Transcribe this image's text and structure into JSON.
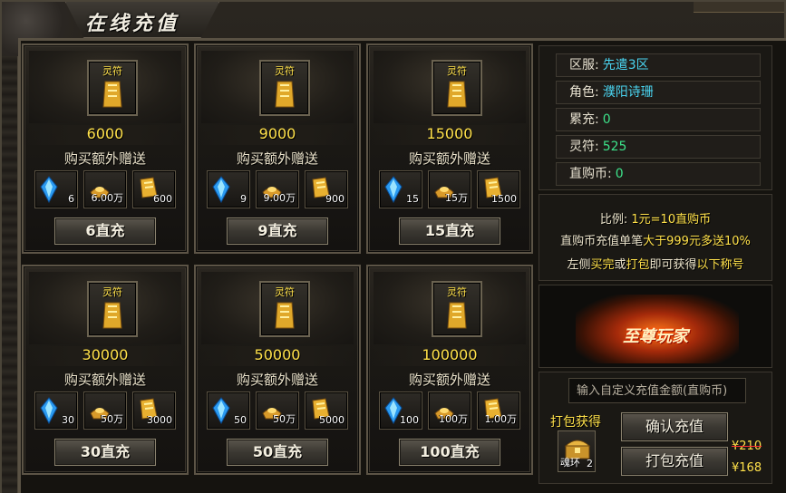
{
  "window": {
    "title": "在线充值"
  },
  "packages": [
    {
      "item_label": "灵符",
      "amount": "6000",
      "bonus_title": "购买额外赠送",
      "gifts": [
        "6",
        "6.00万",
        "600"
      ],
      "button": "6直充"
    },
    {
      "item_label": "灵符",
      "amount": "9000",
      "bonus_title": "购买额外赠送",
      "gifts": [
        "9",
        "9.00万",
        "900"
      ],
      "button": "9直充"
    },
    {
      "item_label": "灵符",
      "amount": "15000",
      "bonus_title": "购买额外赠送",
      "gifts": [
        "15",
        "15万",
        "1500"
      ],
      "button": "15直充"
    },
    {
      "item_label": "灵符",
      "amount": "30000",
      "bonus_title": "购买额外赠送",
      "gifts": [
        "30",
        "50万",
        "3000"
      ],
      "button": "30直充"
    },
    {
      "item_label": "灵符",
      "amount": "50000",
      "bonus_title": "购买额外赠送",
      "gifts": [
        "50",
        "50万",
        "5000"
      ],
      "button": "50直充"
    },
    {
      "item_label": "灵符",
      "amount": "100000",
      "bonus_title": "购买额外赠送",
      "gifts": [
        "100",
        "100万",
        "1.00万"
      ],
      "button": "100直充"
    }
  ],
  "account": {
    "server_label": "区服:",
    "server": "先遣3区",
    "role_label": "角色:",
    "role": "濮阳诗珊",
    "total_label": "累充:",
    "total": "0",
    "talisman_label": "灵符:",
    "talisman": "525",
    "direct_label": "直购币:",
    "direct": "0"
  },
  "rate": {
    "line1_a": "比例: ",
    "line1_b": "1元=10直购币",
    "line2_a": "直购币充值单笔",
    "line2_b": "大于999元多送10%",
    "line3_a": "左侧",
    "line3_b": "买完",
    "line3_c": "或",
    "line3_d": "打包",
    "line3_e": "即可获得",
    "line3_f": "以下称号"
  },
  "banner": {
    "title": "至尊玩家"
  },
  "bottom": {
    "input_placeholder": "输入自定义充值金额(直购币)",
    "pack_label": "打包获得",
    "pack_item_name": "魂环",
    "pack_item_count": "2",
    "confirm_button": "确认充值",
    "pack_button": "打包充值",
    "old_price": "¥210",
    "new_price": "¥168"
  },
  "colors": {
    "gold": "#ffe14a",
    "green": "#3de28a",
    "cyan": "#4ad4f0"
  },
  "icons": {
    "gift1": "blue-crystal-icon",
    "gift2": "gold-ingot-icon",
    "gift3": "gold-talisman-icon"
  }
}
